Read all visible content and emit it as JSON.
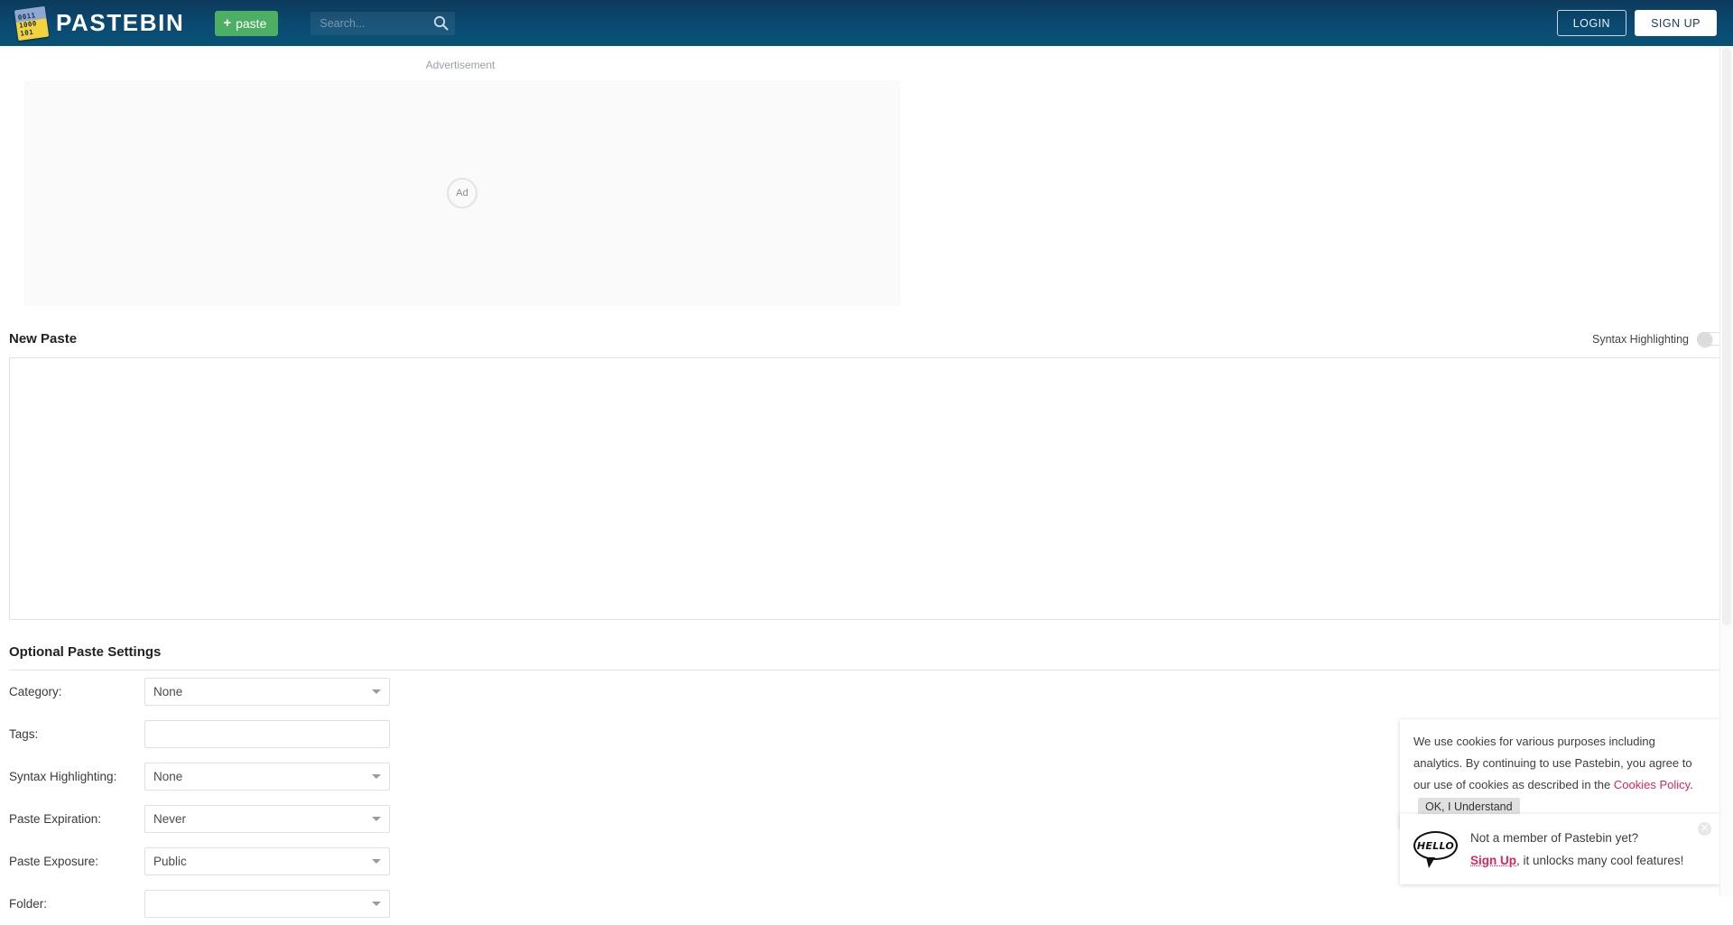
{
  "header": {
    "logo_text": "PASTEBIN",
    "logo_bits": [
      "0011",
      "1000",
      "101"
    ],
    "paste_button": "paste",
    "plus_icon": "+",
    "search_placeholder": "Search...",
    "search_value": "",
    "login_label": "LOGIN",
    "signup_label": "SIGN UP",
    "bg_color": "#0a4a72"
  },
  "ad": {
    "label": "Advertisement",
    "placeholder_text": "Ad"
  },
  "new_paste": {
    "title": "New Paste",
    "syntax_highlight_label": "Syntax Highlighting",
    "syntax_highlight_on": false,
    "textarea_value": "",
    "textarea_placeholder": ""
  },
  "optional_settings": {
    "title": "Optional Paste Settings",
    "fields": [
      {
        "label": "Category:",
        "value": "None",
        "type": "select"
      },
      {
        "label": "Tags:",
        "value": "",
        "type": "text"
      },
      {
        "label": "Syntax Highlighting:",
        "value": "None",
        "type": "select"
      },
      {
        "label": "Paste Expiration:",
        "value": "Never",
        "type": "select"
      },
      {
        "label": "Paste Exposure:",
        "value": "Public",
        "type": "select"
      },
      {
        "label": "Folder:",
        "value": "",
        "type": "select"
      }
    ]
  },
  "cookie_notice": {
    "text_part1": "We use cookies for various purposes including analytics. By continuing to use Pastebin, you agree to our use of cookies as described in the ",
    "link_text": "Cookies Policy",
    "text_part2": ".",
    "button_label": "OK, I Understand",
    "link_color": "#e0245e"
  },
  "signup_promo": {
    "icon_text": "HELLO",
    "line1": "Not a member of Pastebin yet?",
    "link_text": "Sign Up",
    "line2_rest": ", it unlocks many cool features!",
    "close_icon": "✕"
  }
}
